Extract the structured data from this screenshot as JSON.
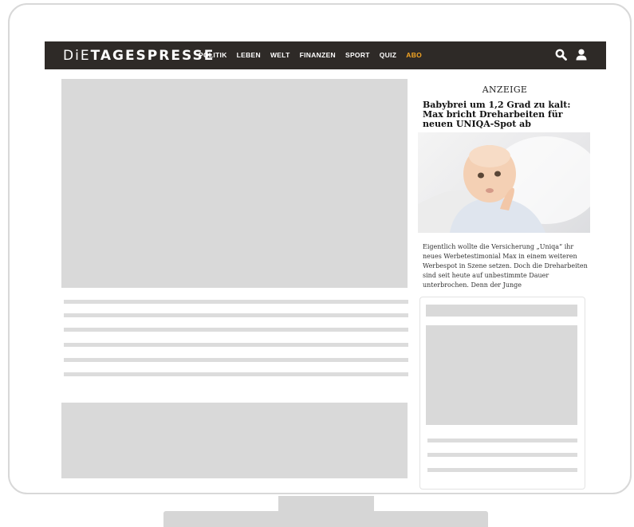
{
  "site": {
    "logo_thin": "DiE",
    "logo_bold": "TAGESPRESSE"
  },
  "nav": {
    "items": [
      {
        "label": "POLITIK"
      },
      {
        "label": "LEBEN"
      },
      {
        "label": "WELT"
      },
      {
        "label": "FINANZEN"
      },
      {
        "label": "SPORT"
      },
      {
        "label": "QUIZ"
      },
      {
        "label": "ABO"
      }
    ],
    "accent_color": "#f5a623",
    "bar_color": "#2e2a27",
    "icons": [
      "search-icon",
      "user-icon"
    ]
  },
  "ad": {
    "label": "ANZEIGE",
    "headline": "Babybrei um 1,2 Grad zu kalt: Max bricht Dreharbeiten für neuen UNIQA-Spot ab",
    "image": "baby-photo",
    "text": "Eigentlich wollte die Versicherung „Uniqa“ ihr neues Werbetestimonial Max in einem weiteren Werbespot in Szene setzen. Doch die Dreharbeiten sind seit heute auf unbestimmte Dauer unterbrochen. Denn der Junge"
  }
}
